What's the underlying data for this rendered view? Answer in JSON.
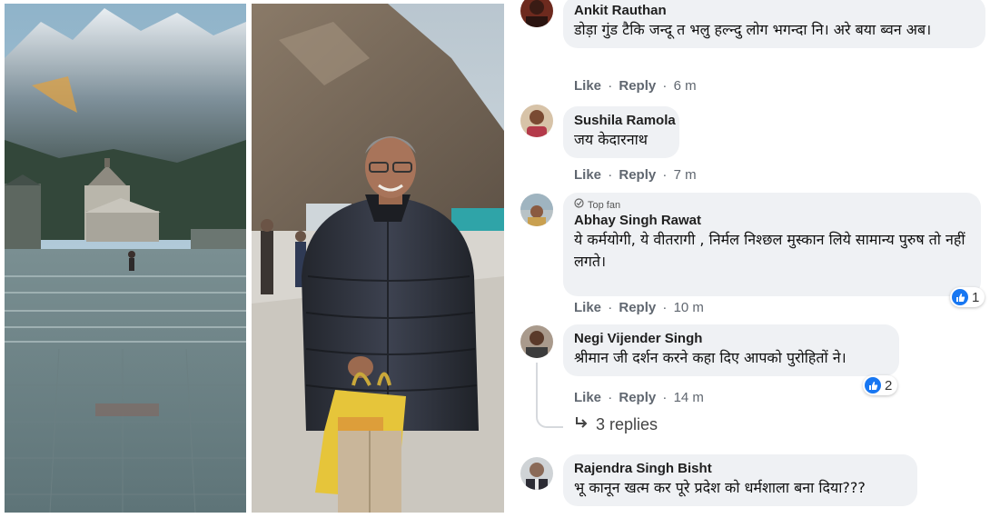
{
  "comments": [
    {
      "author": "Ankit Rauthan",
      "text": "डोड़ा गुंड टैकि जन्दू त भलु हल्न्दु लोग भगन्दा नि। अरे बया ब्वन अब।",
      "like": "Like",
      "reply": "Reply",
      "time": "6 m"
    },
    {
      "author": "Sushila Ramola",
      "text": "जय केदारनाथ",
      "like": "Like",
      "reply": "Reply",
      "time": "7 m"
    },
    {
      "badge": "Top fan",
      "author": "Abhay Singh Rawat",
      "text": "ये कर्मयोगी, ये वीतरागी , निर्मल निश्छल मुस्कान लिये सामान्य पुरुष तो नहीं लगते।",
      "like": "Like",
      "reply": "Reply",
      "time": "10 m",
      "reactions": "1"
    },
    {
      "author": "Negi Vijender Singh",
      "text": "श्रीमान जी दर्शन करने कहा दिए आपको पुरोहितों ने।",
      "like": "Like",
      "reply": "Reply",
      "time": "14 m",
      "reactions": "2",
      "replies": "3 replies"
    },
    {
      "author": "Rajendra Singh Bisht",
      "text": "भू कानून खत्म कर पूरे प्रदेश को धर्मशाला बना दिया???"
    }
  ],
  "separator": "·",
  "icons": {
    "like": "thumbs-up-icon",
    "reply_arrow": "reply-arrow-icon",
    "top_fan": "top-fan-icon"
  },
  "colors": {
    "bubble": "#eff1f4",
    "like_blue": "#1877f2",
    "action_grey": "#606770"
  }
}
